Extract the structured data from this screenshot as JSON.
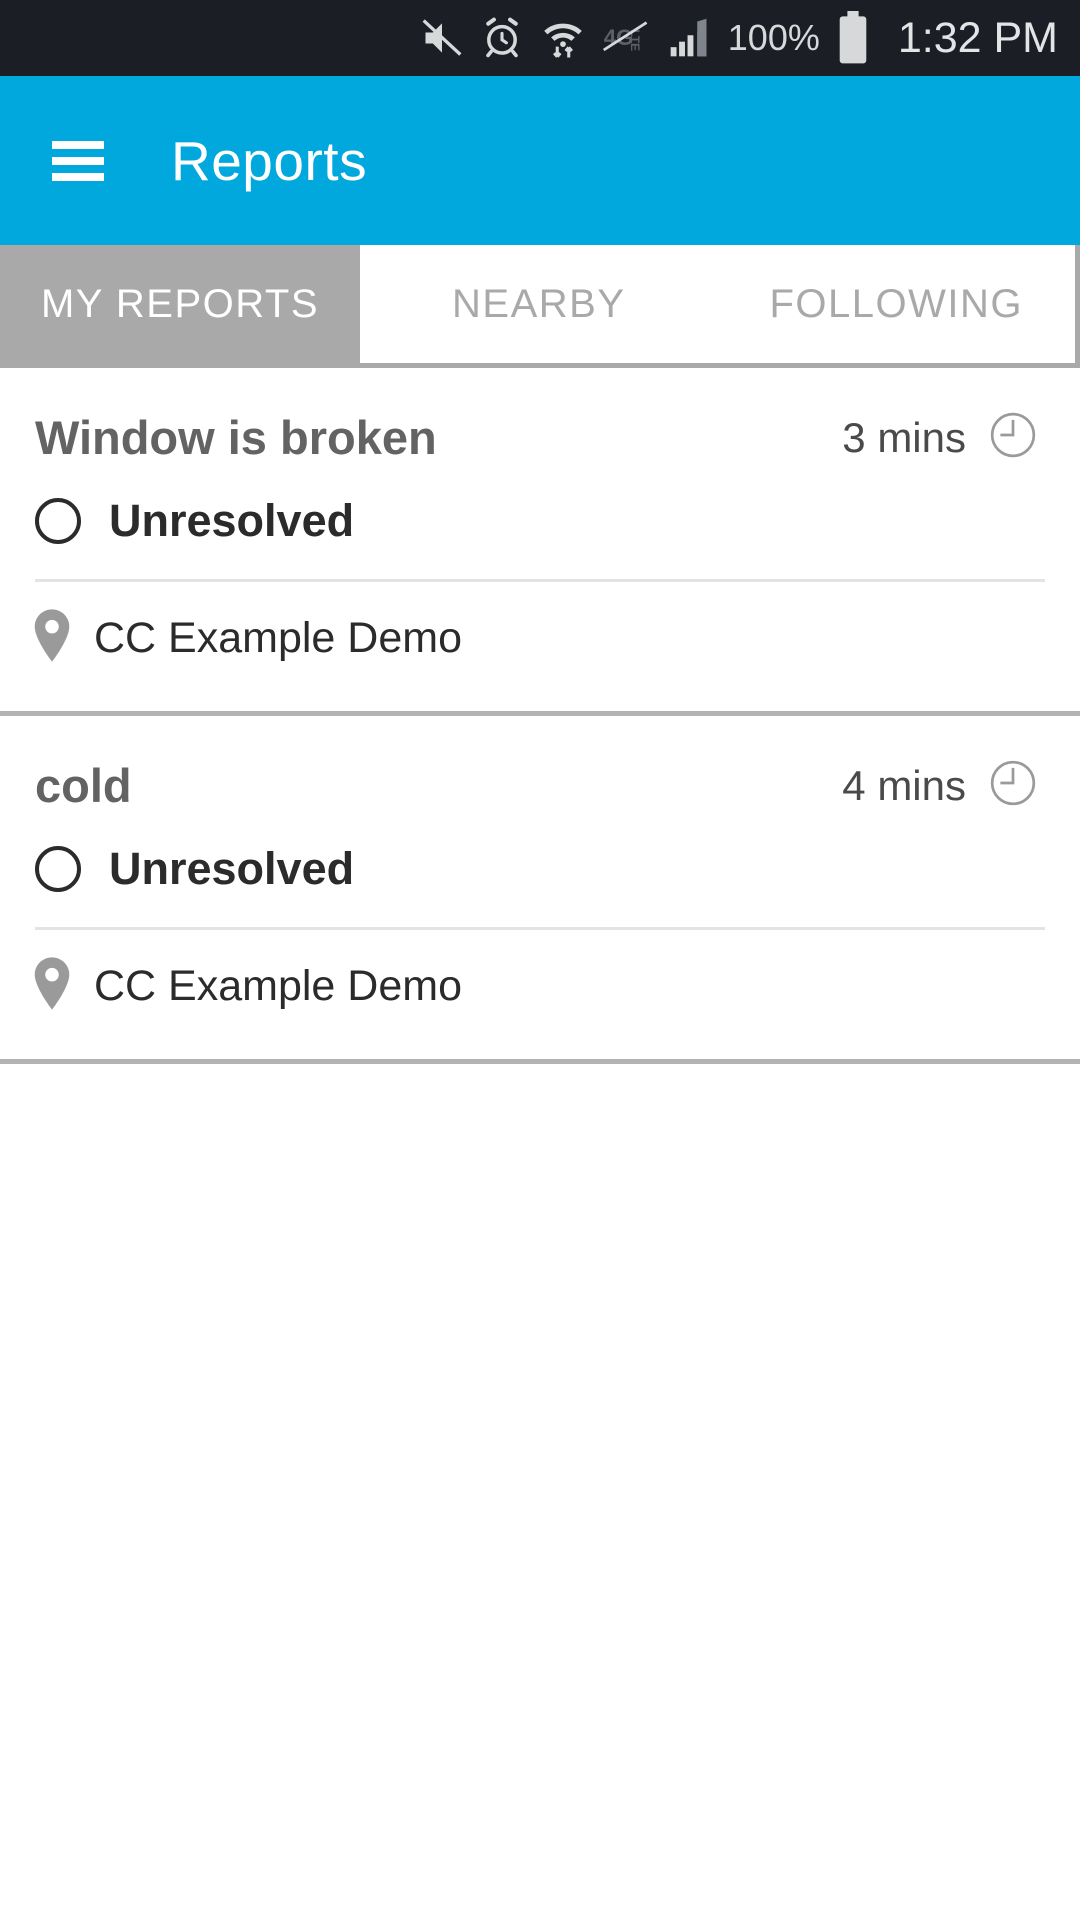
{
  "status_bar": {
    "icons": [
      "mute-icon",
      "alarm-clock-icon",
      "wifi-data-transfer-icon",
      "lte-disabled-icon",
      "cellular-signal-icon"
    ],
    "battery_percent": "100%",
    "battery_icon": "battery-full-icon",
    "time": "1:32 PM",
    "background_color": "#1b1e24"
  },
  "app_bar": {
    "menu_icon": "hamburger-menu-icon",
    "title": "Reports",
    "background_color": "#00a8dd",
    "text_color": "#ffffff"
  },
  "tabs": {
    "selected_index": 0,
    "items": [
      {
        "label": "MY REPORTS"
      },
      {
        "label": "NEARBY"
      },
      {
        "label": "FOLLOWING"
      }
    ],
    "selected_background": "#a9a9a9",
    "unselected_text_color": "#a9a9a9"
  },
  "reports": [
    {
      "title": "Window is broken",
      "time_ago": "3 mins",
      "clock_icon": "clock-icon",
      "status": "Unresolved",
      "status_icon": "unresolved-circle-icon",
      "location_icon": "map-pin-icon",
      "location": "CC Example Demo"
    },
    {
      "title": "cold",
      "time_ago": "4 mins",
      "clock_icon": "clock-icon",
      "status": "Unresolved",
      "status_icon": "unresolved-circle-icon",
      "location_icon": "map-pin-icon",
      "location": "CC Example Demo"
    }
  ]
}
